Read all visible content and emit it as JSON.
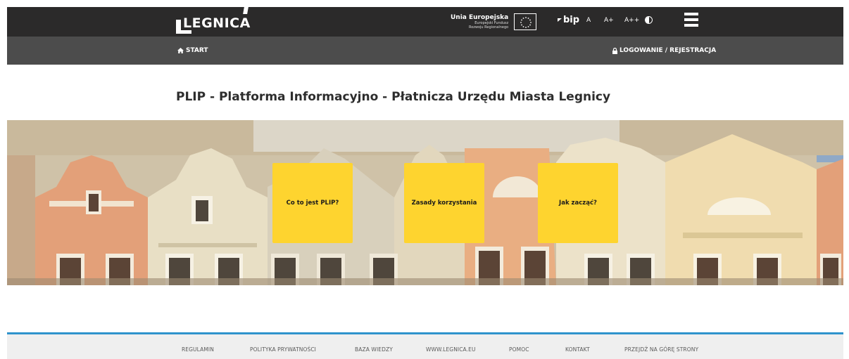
{
  "header": {
    "logo_text": "LEGNICA",
    "eu_title": "Unia Europejska",
    "eu_sub1": "Europejski Fundusz",
    "eu_sub2": "Rozwoju Regionalnego",
    "bip_label": "bip",
    "font_sizes": [
      "A",
      "A+",
      "A++"
    ]
  },
  "nav": {
    "start_label": "START",
    "login_label": "LOGOWANIE / REJESTRACJA"
  },
  "main": {
    "title": "PLIP - Platforma Informacyjno - Płatnicza Urzędu Miasta Legnicy",
    "tiles": [
      "Co to jest PLIP?",
      "Zasady korzystania",
      "Jak zacząć?"
    ]
  },
  "footer": {
    "links": [
      "REGULAMIN",
      "POLITYKA PRYWATNOŚCI",
      "BAZA WIEDZY",
      "WWW.LEGNICA.EU",
      "POMOC",
      "KONTAKT",
      "PRZEJDŹ NA GÓRĘ STRONY"
    ]
  },
  "colors": {
    "topbar": "#2b2a2a",
    "navbar": "#4c4c4c",
    "tile": "#fed42f",
    "footer_accent": "#2f93cc",
    "footer_bg": "#efefef"
  }
}
